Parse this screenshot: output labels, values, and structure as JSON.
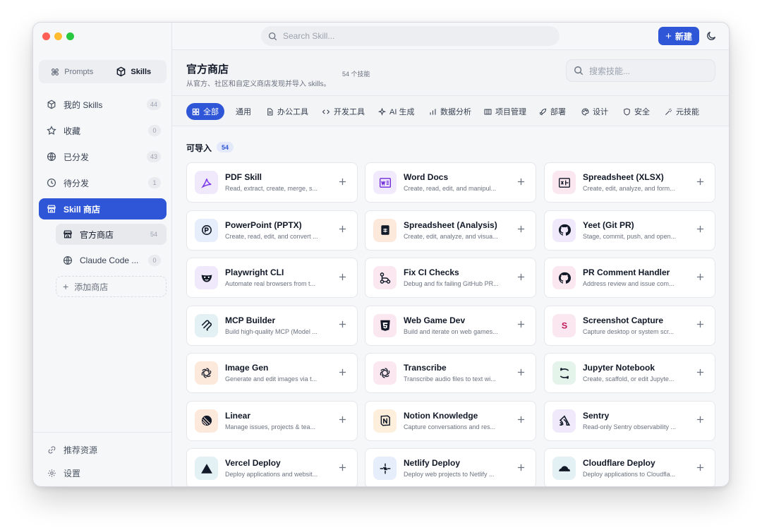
{
  "colors": {
    "accent": "#2f56d6",
    "close": "#ff5f57",
    "minimize": "#febc2e",
    "maximize": "#28c840"
  },
  "sidebar": {
    "segment": [
      {
        "label": "Prompts",
        "icon": "command-icon"
      },
      {
        "label": "Skills",
        "icon": "cube-icon"
      }
    ],
    "items": [
      {
        "label": "我的 Skills",
        "count": "44",
        "icon": "cube-icon"
      },
      {
        "label": "收藏",
        "count": "0",
        "icon": "star-icon"
      },
      {
        "label": "已分发",
        "count": "43",
        "icon": "globe-icon"
      },
      {
        "label": "待分发",
        "count": "1",
        "icon": "clock-icon"
      },
      {
        "label": "Skill 商店",
        "icon": "store-icon"
      }
    ],
    "stores": [
      {
        "label": "官方商店",
        "count": "54",
        "icon": "store-icon"
      },
      {
        "label": "Claude Code ...",
        "count": "0",
        "icon": "globe-icon"
      }
    ],
    "add_store": "添加商店",
    "bottom": [
      {
        "label": "推荐资源",
        "icon": "link-icon"
      },
      {
        "label": "设置",
        "icon": "gear-icon"
      }
    ]
  },
  "topbar": {
    "search_placeholder": "Search Skill...",
    "new_label": "新建"
  },
  "store": {
    "title": "官方商店",
    "subtitle": "从官方、社区和自定义商店发现并导入 skills。",
    "count": "54 个技能",
    "search_placeholder": "搜索技能..."
  },
  "categories": [
    {
      "label": "全部",
      "icon": "grid-icon"
    },
    {
      "label": "通用",
      "icon": ""
    },
    {
      "label": "办公工具",
      "icon": "doc-icon"
    },
    {
      "label": "开发工具",
      "icon": "code-icon"
    },
    {
      "label": "AI 生成",
      "icon": "sparkle-icon"
    },
    {
      "label": "数据分析",
      "icon": "bar-chart-icon"
    },
    {
      "label": "项目管理",
      "icon": "kanban-icon"
    },
    {
      "label": "部署",
      "icon": "rocket-icon"
    },
    {
      "label": "设计",
      "icon": "palette-icon"
    },
    {
      "label": "安全",
      "icon": "shield-icon"
    },
    {
      "label": "元技能",
      "icon": "wand-icon"
    }
  ],
  "section": {
    "title": "可导入",
    "count": "54"
  },
  "skills": [
    {
      "title": "PDF Skill",
      "desc": "Read, extract, create, merge, s...",
      "icon": "pdf-icon",
      "bg": "#efe9fb",
      "fg": "#7c3aed"
    },
    {
      "title": "Word Docs",
      "desc": "Create, read, edit, and manipul...",
      "icon": "word-icon",
      "bg": "#f1eafc",
      "fg": "#6d28d9"
    },
    {
      "title": "Spreadsheet (XLSX)",
      "desc": "Create, edit, analyze, and form...",
      "icon": "excel-icon",
      "bg": "#fbe7ef",
      "fg": "#be185d"
    },
    {
      "title": "PowerPoint (PPTX)",
      "desc": "Create, read, edit, and convert ...",
      "icon": "powerpoint-icon",
      "bg": "#e6edfb",
      "fg": "#2f56d6"
    },
    {
      "title": "Spreadsheet (Analysis)",
      "desc": "Create, edit, analyze, and visua...",
      "icon": "sheet-icon",
      "bg": "#fde9dc",
      "fg": "#c2410c"
    },
    {
      "title": "Yeet (Git PR)",
      "desc": "Stage, commit, push, and open...",
      "icon": "github-icon",
      "bg": "#efe9fb",
      "fg": "#111827"
    },
    {
      "title": "Playwright CLI",
      "desc": "Automate real browsers from t...",
      "icon": "mask-icon",
      "bg": "#efe9fb",
      "fg": "#6d28d9"
    },
    {
      "title": "Fix CI Checks",
      "desc": "Debug and fix failing GitHub PR...",
      "icon": "pipeline-icon",
      "bg": "#fbe7ef",
      "fg": "#111827"
    },
    {
      "title": "PR Comment Handler",
      "desc": "Address review and issue com...",
      "icon": "github-icon",
      "bg": "#fbe7ef",
      "fg": "#111827"
    },
    {
      "title": "MCP Builder",
      "desc": "Build high-quality MCP (Model ...",
      "icon": "mcp-icon",
      "bg": "#e3f1f4",
      "fg": "#111827"
    },
    {
      "title": "Web Game Dev",
      "desc": "Build and iterate on web games...",
      "icon": "html5-icon",
      "bg": "#fbe7ef",
      "fg": "#111827"
    },
    {
      "title": "Screenshot Capture",
      "desc": "Capture desktop or system scr...",
      "icon": "s-letter-icon",
      "bg": "#fbe7ef",
      "fg": "#be185d"
    },
    {
      "title": "Image Gen",
      "desc": "Generate and edit images via t...",
      "icon": "openai-icon",
      "bg": "#fde9dc",
      "fg": "#111827"
    },
    {
      "title": "Transcribe",
      "desc": "Transcribe audio files to text wi...",
      "icon": "openai-icon",
      "bg": "#fbe7ef",
      "fg": "#111827"
    },
    {
      "title": "Jupyter Notebook",
      "desc": "Create, scaffold, or edit Jupyte...",
      "icon": "jupyter-icon",
      "bg": "#e5f4ea",
      "fg": "#111827"
    },
    {
      "title": "Linear",
      "desc": "Manage issues, projects & tea...",
      "icon": "linear-icon",
      "bg": "#fde9dc",
      "fg": "#111827"
    },
    {
      "title": "Notion Knowledge",
      "desc": "Capture conversations and res...",
      "icon": "notion-icon",
      "bg": "#fdefdc",
      "fg": "#111827"
    },
    {
      "title": "Sentry",
      "desc": "Read-only Sentry observability ...",
      "icon": "sentry-icon",
      "bg": "#efe9fb",
      "fg": "#111827"
    },
    {
      "title": "Vercel Deploy",
      "desc": "Deploy applications and websit...",
      "icon": "vercel-icon",
      "bg": "#e3f1f4",
      "fg": "#111827"
    },
    {
      "title": "Netlify Deploy",
      "desc": "Deploy web projects to Netlify ...",
      "icon": "netlify-icon",
      "bg": "#e6edfb",
      "fg": "#111827"
    },
    {
      "title": "Cloudflare Deploy",
      "desc": "Deploy applications to Cloudfla...",
      "icon": "cloud-icon",
      "bg": "#e3f1f4",
      "fg": "#111827"
    }
  ]
}
